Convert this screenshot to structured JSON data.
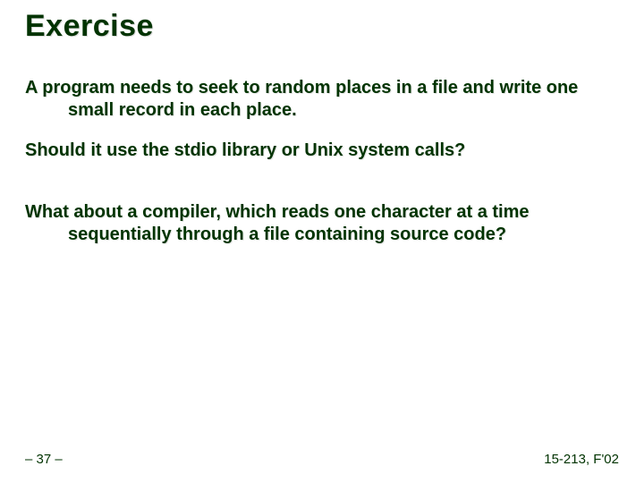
{
  "title": "Exercise",
  "paragraphs": {
    "p1": "A program needs to seek to random places in a file and write one small record in each place.",
    "p2": "Should it use the stdio library or Unix system calls?",
    "p3": "What about a compiler, which reads one character at a time sequentially through a file containing source code?"
  },
  "footer": {
    "left": "– 37 –",
    "right": "15-213, F'02"
  }
}
